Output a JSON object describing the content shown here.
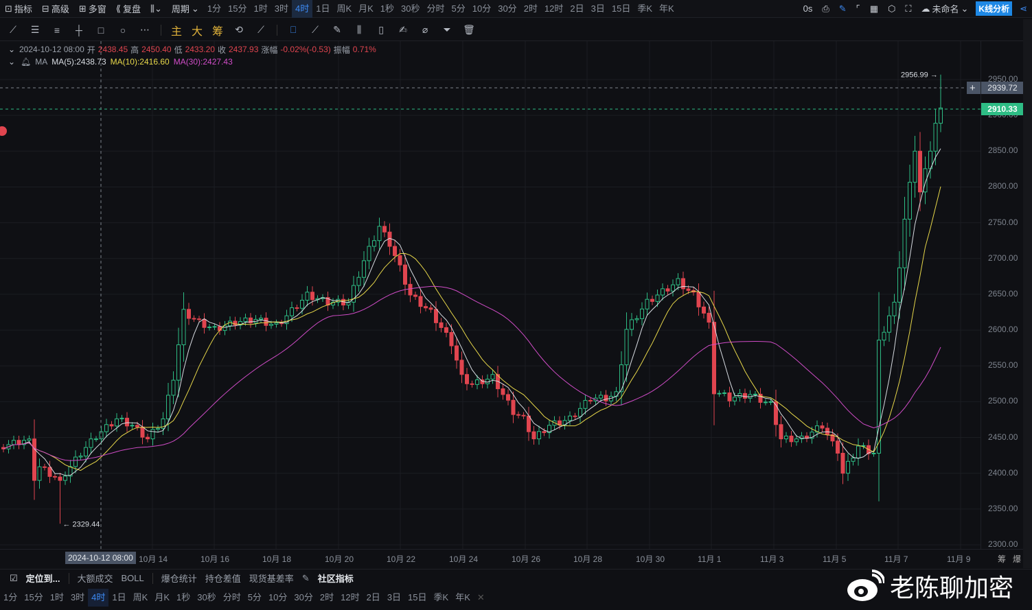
{
  "topbar": {
    "items": [
      "指标",
      "高级",
      "多窗",
      "复盘"
    ],
    "period": "周期",
    "timeframes": [
      "1分",
      "15分",
      "1时",
      "3时",
      "4时",
      "1日",
      "周K",
      "月K",
      "1秒",
      "30秒",
      "分时",
      "5分",
      "10分",
      "30分",
      "2时",
      "12时",
      "2日",
      "3日",
      "15日",
      "季K",
      "年K"
    ],
    "active": "4时",
    "timer": "0s",
    "layout_name": "未命名",
    "analysis_btn": "K线分析"
  },
  "drawbar": {
    "labels": [
      "主",
      "大",
      "筹"
    ]
  },
  "info": {
    "date": "2024-10-12 08:00",
    "open_l": "开",
    "open": "2438.45",
    "high_l": "高",
    "high": "2450.40",
    "low_l": "低",
    "low": "2433.20",
    "close_l": "收",
    "close": "2437.93",
    "chg_l": "涨幅",
    "chg": "-0.02%(-0.53)",
    "amp_l": "振幅",
    "amp": "0.71%"
  },
  "ma": {
    "label": "MA",
    "ma5": "MA(5):2438.73",
    "ma10": "MA(10):2416.60",
    "ma30": "MA(30):2427.43"
  },
  "price_axis": {
    "ticks": [
      "2950.00",
      "2900.00",
      "2850.00",
      "2800.00",
      "2750.00",
      "2700.00",
      "2650.00",
      "2600.00",
      "2550.00",
      "2500.00",
      "2450.00",
      "2400.00",
      "2350.00",
      "2300.00"
    ],
    "crosshair": "2939.72",
    "last": "2910.33"
  },
  "date_axis": {
    "crosshair": "2024-10-12 08:00",
    "labels": [
      "10月 14",
      "10月 16",
      "10月 18",
      "10月 20",
      "10月 22",
      "10月 24",
      "10月 26",
      "10月 28",
      "10月 30",
      "11月 1",
      "11月 3",
      "11月 5",
      "11月 7",
      "11月 9"
    ],
    "right": [
      "筹",
      "爆"
    ]
  },
  "indicator_bar": {
    "locate": "定位到...",
    "items": [
      "大额成交",
      "BOLL",
      "爆仓统计",
      "持仓差值",
      "现货基差率"
    ],
    "community": "社区指标"
  },
  "bottom_tf": {
    "items": [
      "1分",
      "15分",
      "1时",
      "3时",
      "4时",
      "1日",
      "周K",
      "月K",
      "1秒",
      "30秒",
      "分时",
      "5分",
      "10分",
      "30分",
      "2时",
      "12时",
      "2日",
      "3日",
      "15日",
      "季K",
      "年K"
    ],
    "active": "4时",
    "close": "✕"
  },
  "watermark": "老陈聊加密",
  "colors": {
    "up": "#2ebd85",
    "down": "#e0454f",
    "ma5": "#d8dce2",
    "ma10": "#e8d84a",
    "ma30": "#d04cc7",
    "accent": "#1e88e5"
  },
  "chart_data": {
    "type": "candlestick",
    "interval": "4h",
    "title": "",
    "ylim": [
      2300,
      2950
    ],
    "close_keypoints": [
      [
        0,
        2438
      ],
      [
        5,
        2448
      ],
      [
        6,
        2390
      ],
      [
        7,
        2409
      ],
      [
        11,
        2390
      ],
      [
        12,
        2400
      ],
      [
        15,
        2428
      ],
      [
        18,
        2452
      ],
      [
        22,
        2476
      ],
      [
        25,
        2467
      ],
      [
        28,
        2448
      ],
      [
        31,
        2476
      ],
      [
        33,
        2534
      ],
      [
        35,
        2625
      ],
      [
        38,
        2611
      ],
      [
        41,
        2601
      ],
      [
        45,
        2611
      ],
      [
        49,
        2615
      ],
      [
        53,
        2606
      ],
      [
        55,
        2620
      ],
      [
        59,
        2649
      ],
      [
        63,
        2639
      ],
      [
        67,
        2639
      ],
      [
        70,
        2697
      ],
      [
        73,
        2745
      ],
      [
        75,
        2721
      ],
      [
        77,
        2687
      ],
      [
        79,
        2649
      ],
      [
        83,
        2625
      ],
      [
        87,
        2582
      ],
      [
        89,
        2534
      ],
      [
        91,
        2524
      ],
      [
        95,
        2534
      ],
      [
        99,
        2486
      ],
      [
        101,
        2476
      ],
      [
        103,
        2448
      ],
      [
        106,
        2467
      ],
      [
        110,
        2476
      ],
      [
        114,
        2505
      ],
      [
        117,
        2505
      ],
      [
        119,
        2510
      ],
      [
        121,
        2601
      ],
      [
        125,
        2639
      ],
      [
        127,
        2649
      ],
      [
        131,
        2668
      ],
      [
        134,
        2649
      ],
      [
        137,
        2611
      ],
      [
        138,
        2515
      ],
      [
        141,
        2505
      ],
      [
        145,
        2510
      ],
      [
        149,
        2496
      ],
      [
        151,
        2448
      ],
      [
        155,
        2448
      ],
      [
        159,
        2467
      ],
      [
        162,
        2428
      ],
      [
        163,
        2400
      ],
      [
        166,
        2438
      ],
      [
        169,
        2428
      ],
      [
        170,
        2582
      ],
      [
        173,
        2639
      ],
      [
        174,
        2687
      ],
      [
        175,
        2755
      ],
      [
        177,
        2850
      ],
      [
        178,
        2793
      ],
      [
        180,
        2850
      ],
      [
        181,
        2889
      ],
      [
        182,
        2910.33
      ]
    ],
    "annotations": {
      "max": "2956.99",
      "min": "2329.44"
    },
    "max_index": 182,
    "min_index": 11,
    "ma_periods": [
      5,
      10,
      30
    ]
  }
}
